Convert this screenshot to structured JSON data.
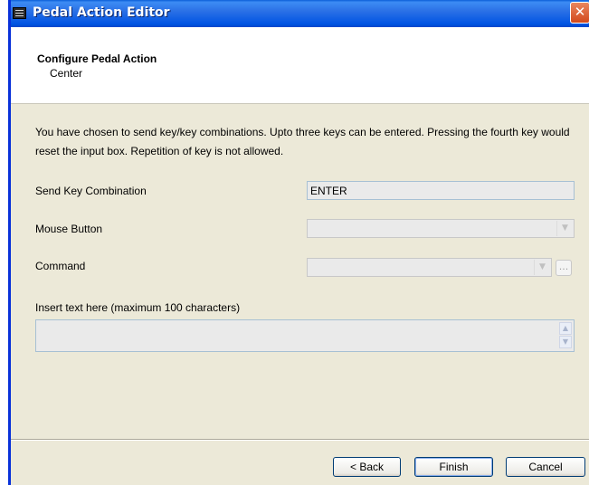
{
  "window": {
    "title": "Pedal Action Editor",
    "close_glyph": "✕"
  },
  "header": {
    "title": "Configure Pedal Action",
    "subtitle": "Center"
  },
  "description": "You have chosen to send key/key combinations. Upto three keys can be entered. Pressing the fourth key would reset the input box. Repetition of key is not allowed.",
  "fields": {
    "send_key_label": "Send Key Combination",
    "send_key_value": "ENTER",
    "mouse_label": "Mouse Button",
    "mouse_value": "",
    "command_label": "Command",
    "command_value": "",
    "browse_label": "...",
    "insert_text_label": "Insert text here (maximum 100 characters)",
    "insert_text_value": ""
  },
  "buttons": {
    "back": "< Back",
    "finish": "Finish",
    "cancel": "Cancel"
  },
  "icons": {
    "dropdown": "chevron-down-icon",
    "scroll_up": "arrow-up-icon",
    "scroll_down": "arrow-down-icon"
  }
}
